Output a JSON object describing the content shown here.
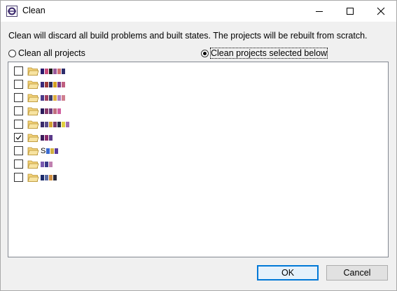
{
  "window": {
    "title": "Clean",
    "app_icon": "eclipse-icon"
  },
  "description": "Clean will discard all build problems and built states.  The projects will be rebuilt from scratch.",
  "options": [
    {
      "label": "Clean all projects",
      "checked": false
    },
    {
      "label": "Clean projects selected below",
      "checked": true
    }
  ],
  "projects": [
    {
      "checked": false,
      "label": "",
      "icon": "open-folder-icon",
      "blur": [
        "#2a1a6b",
        "#c94a7a",
        "#1b1b1b",
        "#9a5a9a",
        "#d07070",
        "#2d2d6b"
      ]
    },
    {
      "checked": false,
      "label": "",
      "icon": "open-folder-icon",
      "blur": [
        "#3a2a7a",
        "#9b3b3b",
        "#2a2a5a",
        "#d4a020",
        "#7a3a8a",
        "#c06080"
      ]
    },
    {
      "checked": false,
      "label": "",
      "icon": "open-folder-icon",
      "blur": [
        "#4a3a8a",
        "#a04060",
        "#3a3a6a",
        "#e0b040",
        "#b080c0",
        "#d08090"
      ]
    },
    {
      "checked": false,
      "label": "",
      "icon": "open-folder-icon",
      "blur": [
        "#2a1a5a",
        "#8a3a6a",
        "#6a3a7a",
        "#c07080",
        "#d060a0"
      ]
    },
    {
      "checked": false,
      "label": "",
      "icon": "open-folder-icon",
      "blur": [
        "#3a2a6a",
        "#5a4a8a",
        "#d0a030",
        "#7a3a6a",
        "#2a2a4a",
        "#e0d040",
        "#a070b0"
      ]
    },
    {
      "checked": true,
      "label": "",
      "icon": "open-folder-icon",
      "blur": [
        "#3a1a5a",
        "#8a2a6a",
        "#5a3a8a"
      ]
    },
    {
      "checked": false,
      "label": "S",
      "icon": "open-folder-icon",
      "blur": [
        "#3a6ad0",
        "#d0b040",
        "#5a3a9a"
      ]
    },
    {
      "checked": false,
      "label": "",
      "icon": "open-folder-icon",
      "blur": [
        "#7a5ab0",
        "#3a3a8a",
        "#c080b0"
      ]
    },
    {
      "checked": false,
      "label": "",
      "icon": "open-folder-icon",
      "blur": [
        "#1a2a6a",
        "#5a6aa0",
        "#d09040",
        "#2a2a3a"
      ]
    }
  ],
  "buttons": {
    "ok": "OK",
    "cancel": "Cancel"
  },
  "colors": {
    "accent": "#0078d7",
    "list_border": "#828790",
    "dialog_bg": "#f0f0f0"
  }
}
